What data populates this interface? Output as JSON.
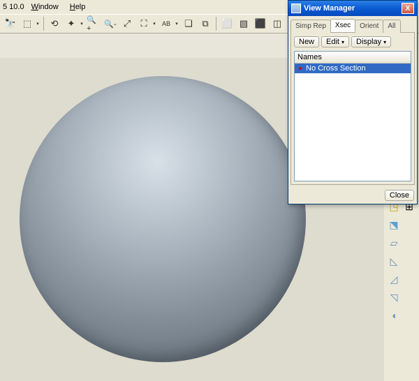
{
  "app": {
    "version_text": "5 10.0"
  },
  "menus": {
    "window": "Window",
    "help": "Help"
  },
  "toolbar": {
    "binoculars": "🔭",
    "selectall": "⬚",
    "dropdown": "▾",
    "redraw": "⟲",
    "centerpoint": "✦",
    "zoomin": "🔍",
    "zoomout": "🔎",
    "zoomfit": "⤢",
    "pan": "⛶",
    "orient": "⬓",
    "layers": "❏",
    "viewmgr": "⧉",
    "shade1": "◫",
    "shade2": "▧",
    "wire1": "⬜",
    "wire2": "⬛"
  },
  "sidebar": {
    "planes": "◳",
    "axes": "⊞",
    "sketch": "⬔",
    "extrude": "▱",
    "revolve": "◺",
    "sweep": "◿",
    "blend": "◹",
    "round": "◖"
  },
  "dialog": {
    "title": "View Manager",
    "close_x": "X",
    "tabs": {
      "simprep": "Simp Rep",
      "xsec": "Xsec",
      "orient": "Orient",
      "all": "All"
    },
    "buttons": {
      "new": "New",
      "edit": "Edit",
      "display": "Display",
      "close": "Close"
    },
    "caret": "▾",
    "list_header": "Names",
    "items": [
      {
        "label": "No Cross Section",
        "selected": true
      }
    ]
  }
}
